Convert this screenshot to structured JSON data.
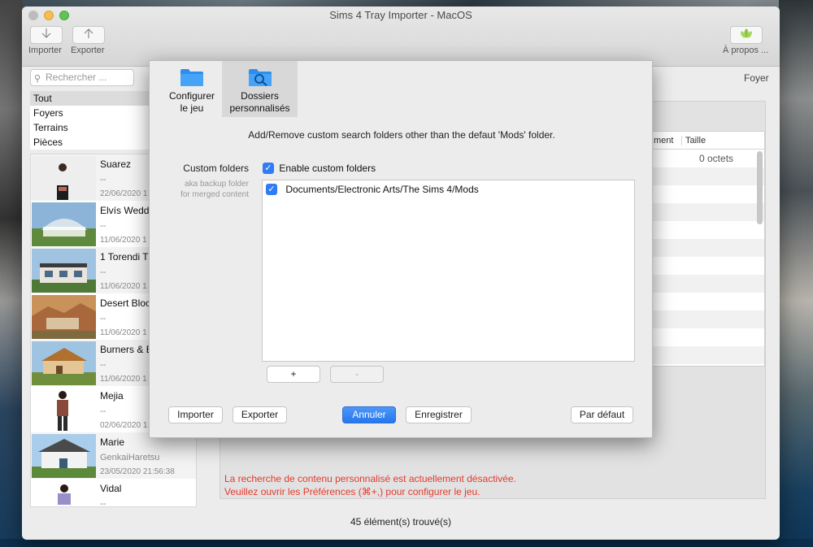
{
  "window": {
    "title": "Sims 4 Tray Importer - MacOS"
  },
  "toolbar": {
    "import_label": "Importer",
    "export_label": "Exporter",
    "about_label": "À propos ..."
  },
  "sidebar": {
    "search_placeholder": "Rechercher ...",
    "filters": [
      {
        "label": "Tout",
        "selected": true
      },
      {
        "label": "Foyers",
        "selected": false
      },
      {
        "label": "Terrains",
        "selected": false
      },
      {
        "label": "Pièces",
        "selected": false
      }
    ],
    "items": [
      {
        "name": "Suarez",
        "author": "--",
        "date": "22/06/2020 1"
      },
      {
        "name": "Elvís Wedd",
        "author": "--",
        "date": "11/06/2020 1"
      },
      {
        "name": "1 Torendi T",
        "author": "--",
        "date": "11/06/2020 1"
      },
      {
        "name": "Desert Bloc",
        "author": "--",
        "date": "11/06/2020 1"
      },
      {
        "name": "Burners & E",
        "author": "--",
        "date": "11/06/2020 1"
      },
      {
        "name": "Mejia",
        "author": "--",
        "date": "02/06/2020 1"
      },
      {
        "name": "Marie",
        "author": "GenkaiHaretsu",
        "date": "23/05/2020 21:56:38"
      },
      {
        "name": "Vidal",
        "author": "--",
        "date": ""
      }
    ]
  },
  "main": {
    "type_label": "Foyer",
    "table_headers": [
      "ment",
      "Taille"
    ],
    "first_size": "0 octets",
    "error_line1": "La recherche de contenu personnalisé est actuellement désactivée.",
    "error_line2": "Veuillez ouvrir les Préférences (⌘+,) pour configurer le jeu.",
    "status": "45  élément(s) trouvé(s)"
  },
  "prefs": {
    "tab1_line1": "Configurer",
    "tab1_line2": "le jeu",
    "tab2_line1": "Dossiers",
    "tab2_line2": "personnalisés",
    "description": "Add/Remove custom search folders other than the defaut 'Mods' folder.",
    "custom_folders_label": "Custom folders",
    "hint_line1": "aka backup folder",
    "hint_line2": "for merged content",
    "enable_label": "Enable custom folders",
    "folders": [
      "Documents/Electronic Arts/The Sims 4/Mods"
    ],
    "add_label": "+",
    "remove_label": "-",
    "import_label": "Importer",
    "export_label": "Exporter",
    "cancel_label": "Annuler",
    "save_label": "Enregistrer",
    "default_label": "Par défaut",
    "checkmark": "✓"
  },
  "colors": {
    "accent": "#2f7cf6",
    "error": "#e5392c"
  },
  "icons": {
    "import": "arrow-down-icon",
    "export": "arrow-up-icon",
    "about": "lotus-icon",
    "search": "magnifier-icon",
    "folder": "folder-icon",
    "custom_folder": "folder-search-icon"
  }
}
